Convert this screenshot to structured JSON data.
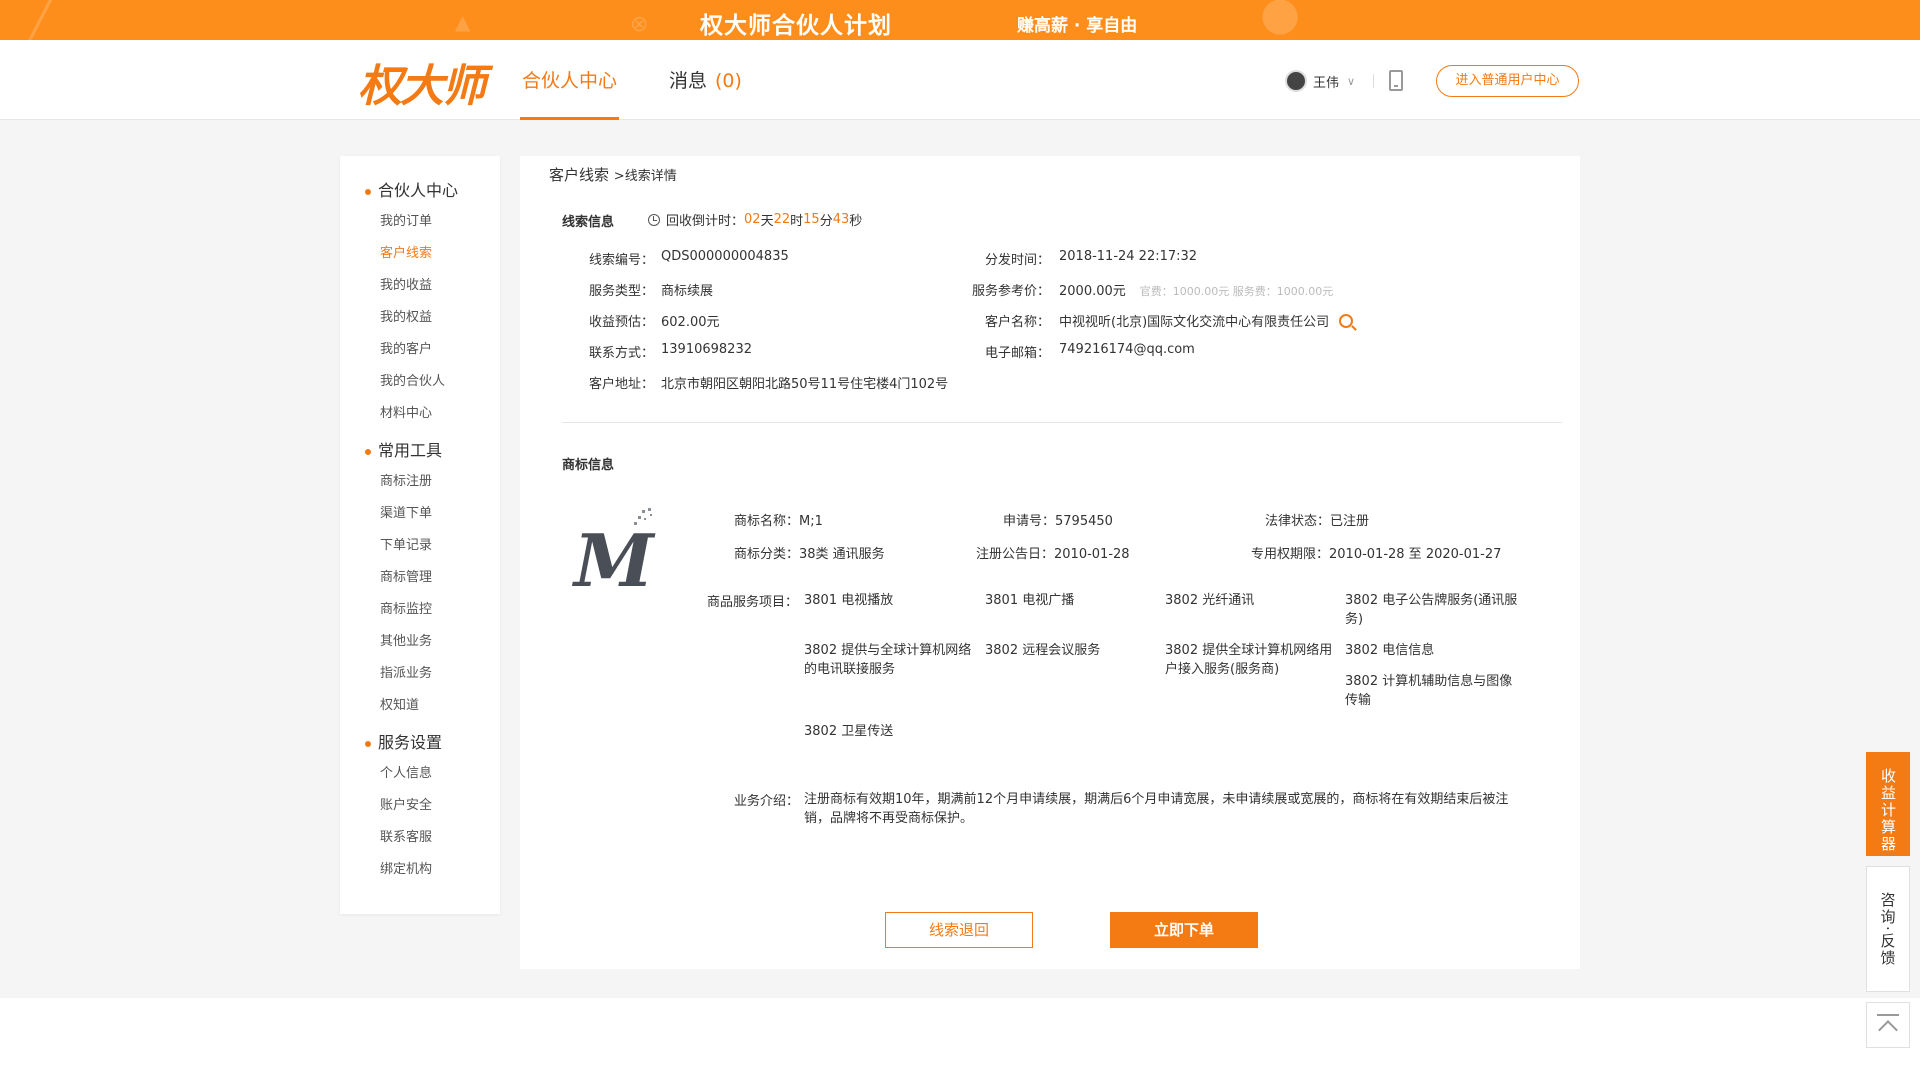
{
  "banner": {
    "title": "权大师合伙人计划",
    "slogan": "赚高薪 · 享自由"
  },
  "header": {
    "logo": "权大师",
    "nav_active": "合伙人中心",
    "nav_msg": "消息",
    "msg_count": "(0)",
    "user_name": "王伟",
    "enter_btn": "进入普通用户中心"
  },
  "sidebar": {
    "groups": [
      {
        "title": "合伙人中心",
        "items": [
          "我的订单",
          "客户线索",
          "我的收益",
          "我的权益",
          "我的客户",
          "我的合伙人",
          "材料中心"
        ]
      },
      {
        "title": "常用工具",
        "items": [
          "商标注册",
          "渠道下单",
          "下单记录",
          "商标管理",
          "商标监控",
          "其他业务",
          "指派业务",
          "权知道"
        ]
      },
      {
        "title": "服务设置",
        "items": [
          "个人信息",
          "账户安全",
          "联系客服",
          "绑定机构"
        ]
      }
    ],
    "active": "客户线索"
  },
  "breadcrumb": {
    "root": "客户线索",
    "sub": ">线索详情"
  },
  "lead": {
    "section_title": "线索信息",
    "countdown_label": "回收倒计时：",
    "days": "02",
    "days_unit": "天",
    "hours": "22",
    "hours_unit": "时",
    "minutes": "15",
    "minutes_unit": "分",
    "seconds": "43",
    "seconds_unit": "秒",
    "fields": {
      "code_label": "线索编号：",
      "code": "QDS000000004835",
      "dispatch_label": "分发时间：",
      "dispatch": "2018-11-24 22:17:32",
      "service_label": "服务类型：",
      "service": "商标续展",
      "price_label": "服务参考价：",
      "price": "2000.00元",
      "fee_note": "官费：1000.00元 服务费：1000.00元",
      "income_label": "收益预估：",
      "income": "602.00元",
      "customer_label": "客户名称：",
      "customer": "中视视听(北京)国际文化交流中心有限责任公司",
      "contact_label": "联系方式：",
      "contact": "13910698232",
      "email_label": "电子邮箱：",
      "email": "749216174@qq.com",
      "address_label": "客户地址：",
      "address": "北京市朝阳区朝阳北路50号11号住宅楼4门102号"
    }
  },
  "trademark": {
    "section_title": "商标信息",
    "name": "商标名称：M;1",
    "app_no": "申请号：5795450",
    "status": "法律状态：已注册",
    "category": "商标分类：38类 通讯服务",
    "pub_date": "注册公告日：2010-01-28",
    "validity": "专用权期限：2010-01-28 至 2020-01-27",
    "services_label": "商品服务项目：",
    "services": [
      "3801 电视播放",
      "3801 电视广播",
      "3802 光纤通讯",
      "3802 电子公告牌服务(通讯服务)",
      "3802 提供与全球计算机网络的电讯联接服务",
      "3802 远程会议服务",
      "3802 提供全球计算机网络用户接入服务(服务商)",
      "3802 电信信息",
      "3802 计算机辅助信息与图像传输",
      "3802 卫星传送"
    ],
    "intro_label": "业务介绍：",
    "intro": "注册商标有效期10年，期满前12个月申请续展，期满后6个月申请宽展，未申请续展或宽展的，商标将在有效期结束后被注销，品牌将不再受商标保护。"
  },
  "actions": {
    "return": "线索退回",
    "order": "立即下单"
  },
  "float": {
    "calc": "收益计算器",
    "feedback": "咨询·反馈"
  }
}
